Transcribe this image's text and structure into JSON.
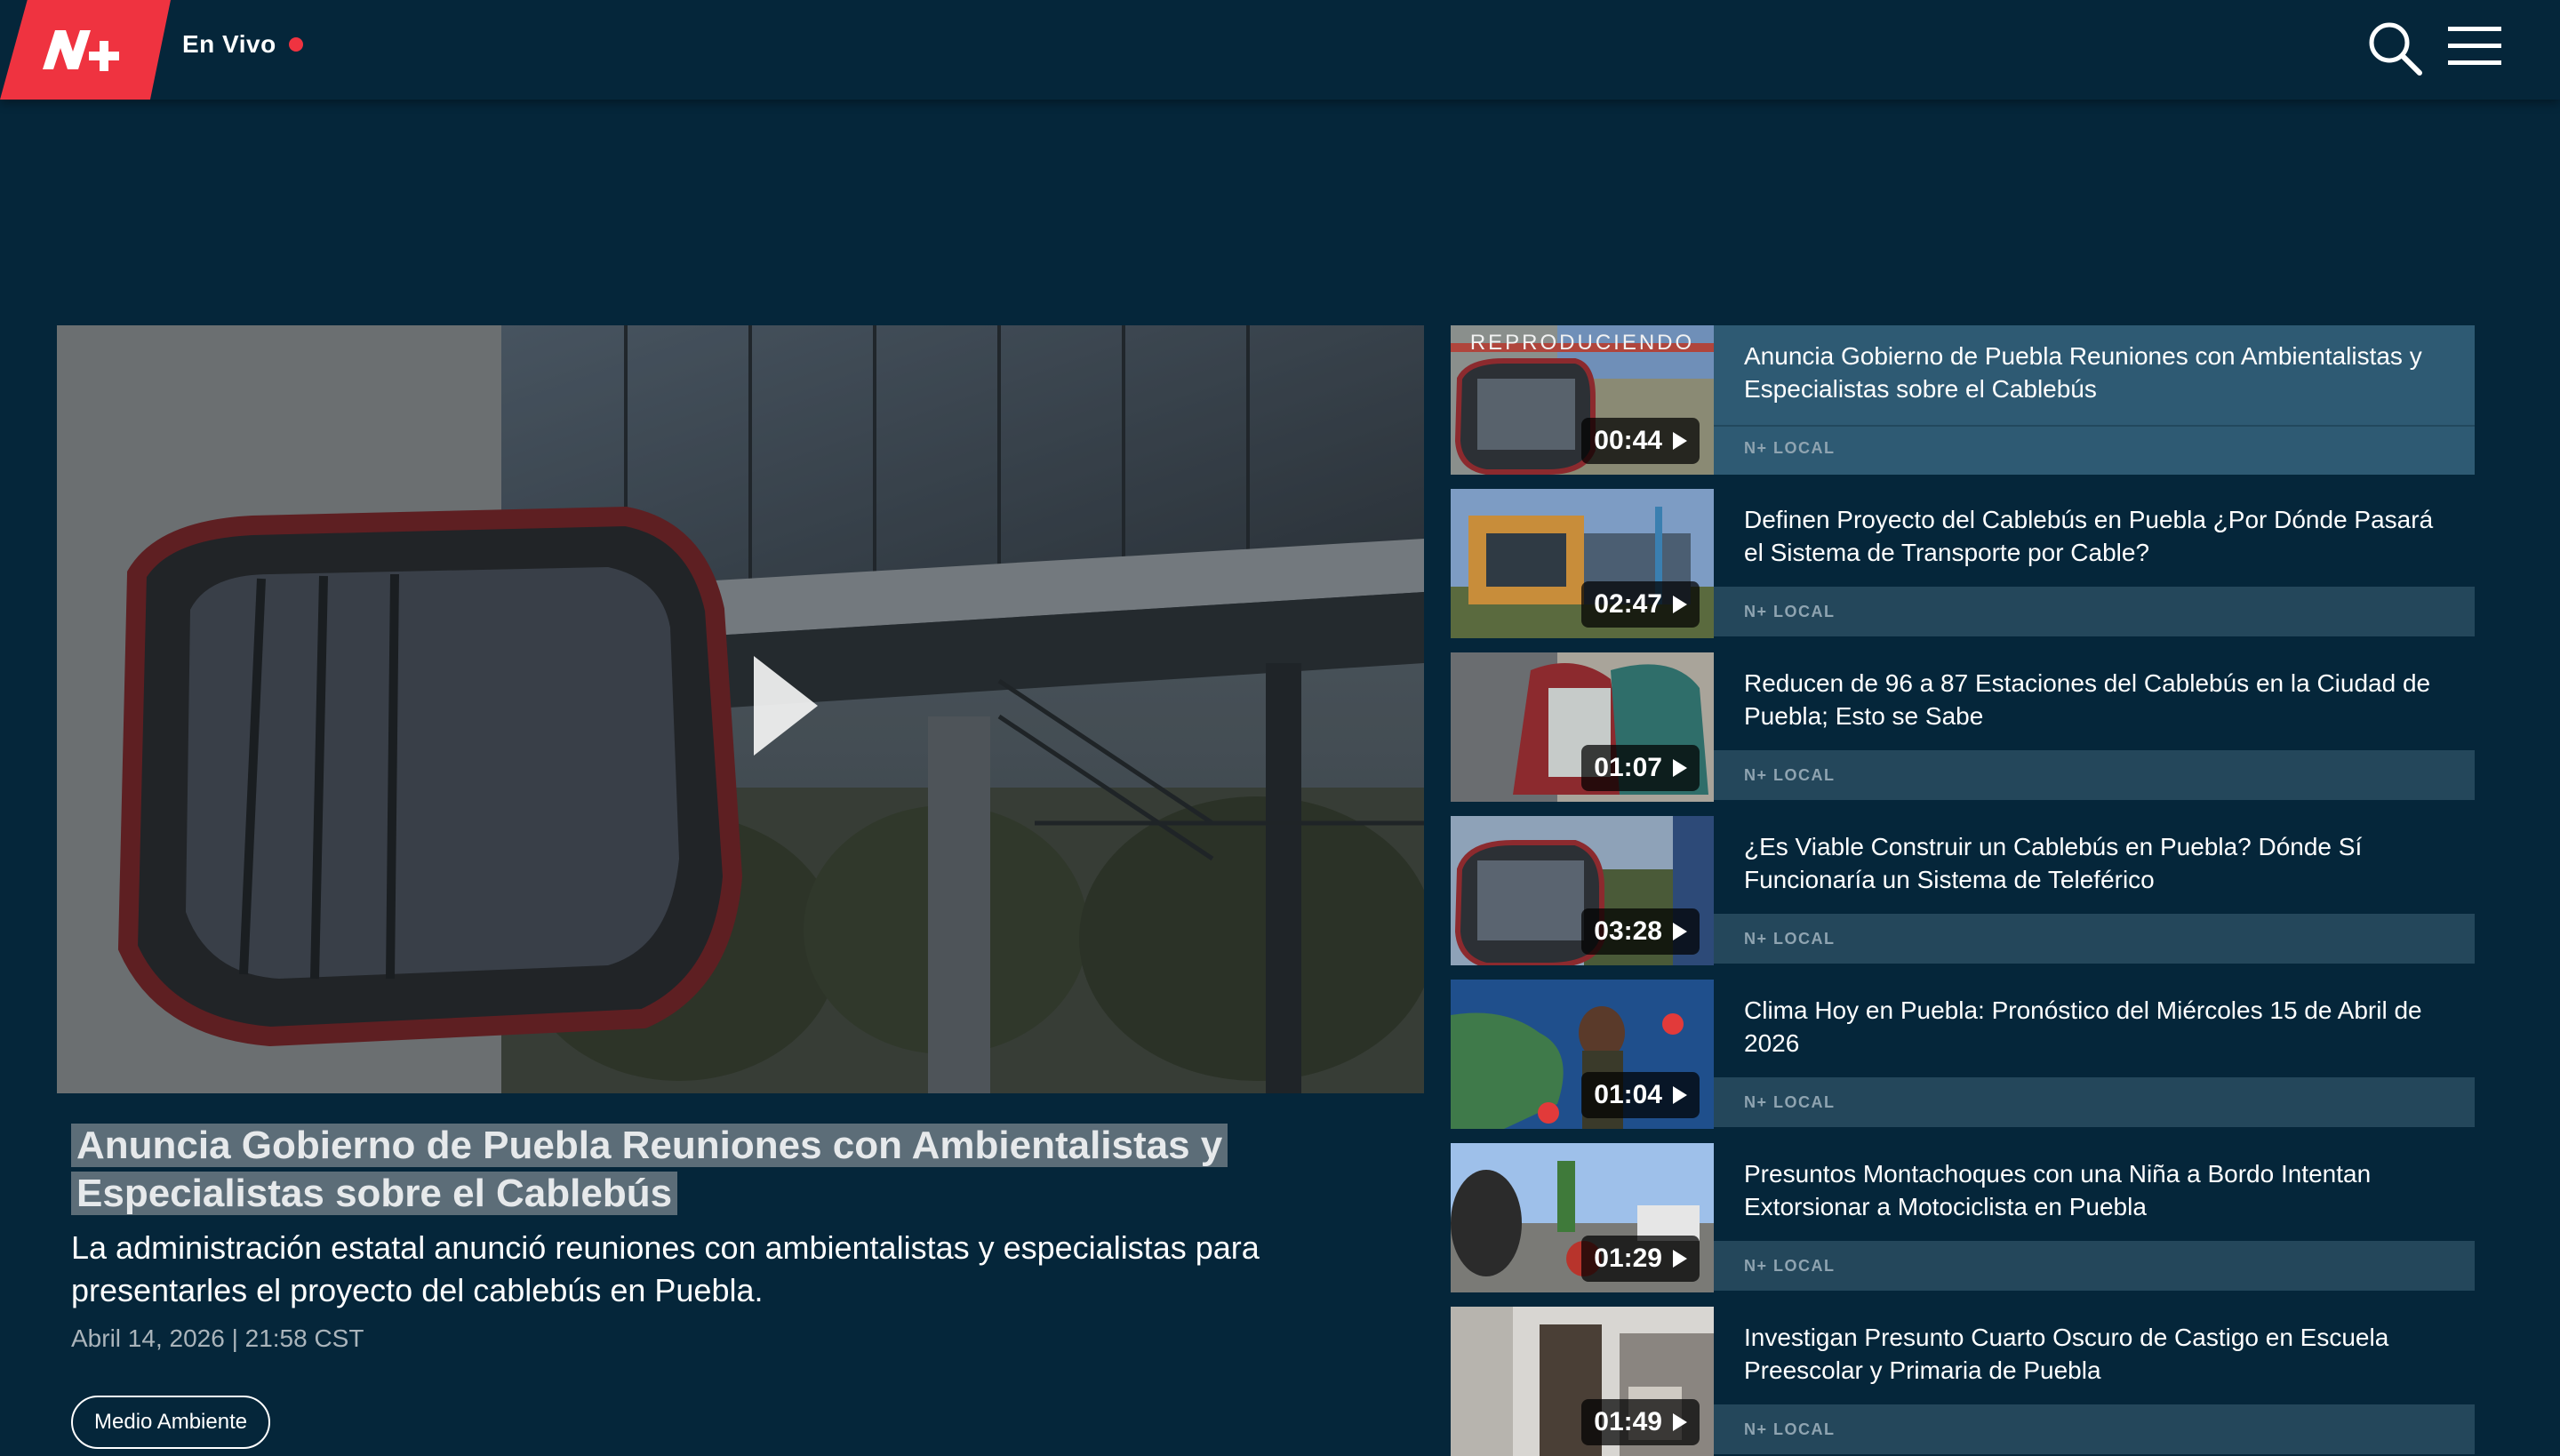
{
  "header": {
    "live_label": "En Vivo",
    "logo_icon": "nplus-logo-icon",
    "search_icon": "search-icon",
    "menu_icon": "hamburger-menu-icon"
  },
  "colors": {
    "background": "#05263a",
    "brand_red": "#ef3340",
    "active_item": "#2e5a73",
    "item_band": "#24475b"
  },
  "main_video": {
    "play_icon": "play-icon",
    "title": "Anuncia Gobierno de Puebla Reuniones con Ambientalistas y Especialistas sobre el Cablebús",
    "summary": "La administración estatal anunció reuniones con ambientalistas y especialistas para presentarles el proyecto del cablebús en Puebla.",
    "date": "Abril 14, 2026 | 21:58 CST",
    "tag": "Medio Ambiente"
  },
  "playlist": {
    "now_playing_label": "REPRODUCIENDO",
    "items": [
      {
        "title": "Anuncia Gobierno de Puebla Reuniones con Ambientalistas y Especialistas sobre el Cablebús",
        "duration": "00:44",
        "tag": "N+ LOCAL"
      },
      {
        "title": "Definen Proyecto del Cablebús en Puebla ¿Por Dónde Pasará el Sistema de Transporte por Cable?",
        "duration": "02:47",
        "tag": "N+ LOCAL"
      },
      {
        "title": "Reducen de 96 a 87 Estaciones del Cablebús en la Ciudad de Puebla; Esto se Sabe",
        "duration": "01:07",
        "tag": "N+ LOCAL"
      },
      {
        "title": "¿Es Viable Construir un Cablebús en Puebla? Dónde Sí Funcionaría un Sistema de Teleférico",
        "duration": "03:28",
        "tag": "N+ LOCAL"
      },
      {
        "title": "Clima Hoy en Puebla: Pronóstico del Miércoles 15 de Abril de 2026",
        "duration": "01:04",
        "tag": "N+ LOCAL"
      },
      {
        "title": "Presuntos Montachoques con una Niña a Bordo Intentan Extorsionar a Motociclista en Puebla",
        "duration": "01:29",
        "tag": "N+ LOCAL"
      },
      {
        "title": "Investigan Presunto Cuarto Oscuro de Castigo en Escuela Preescolar y Primaria de Puebla",
        "duration": "01:49",
        "tag": "N+ LOCAL"
      }
    ]
  }
}
